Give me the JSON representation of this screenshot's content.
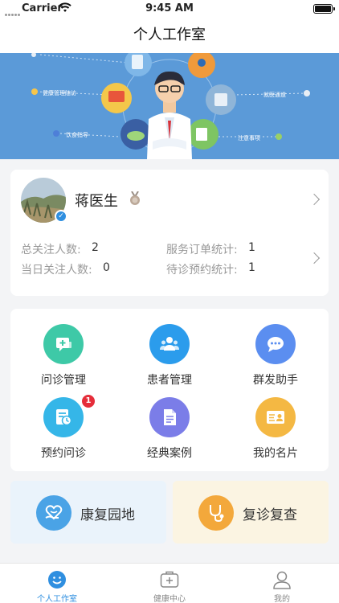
{
  "status_bar": {
    "carrier": "Carrier",
    "time": "9:45 AM"
  },
  "nav": {
    "title": "个人工作室"
  },
  "banner": {
    "labels": [
      "健康管理随访",
      "饮食指导",
      "就医通道",
      "注意事项"
    ]
  },
  "doctor": {
    "name": "蒋医生",
    "stats": {
      "total_followers_label": "总关注人数:",
      "total_followers_value": "2",
      "service_orders_label": "服务订单统计:",
      "service_orders_value": "1",
      "today_followers_label": "当日关注人数:",
      "today_followers_value": "0",
      "pending_appointments_label": "待诊预约统计:",
      "pending_appointments_value": "1"
    }
  },
  "grid": {
    "items": [
      {
        "label": "问诊管理",
        "icon": "consultation-icon",
        "color": "#3ec9a7"
      },
      {
        "label": "患者管理",
        "icon": "patients-icon",
        "color": "#2b9cec"
      },
      {
        "label": "群发助手",
        "icon": "chat-bubble-icon",
        "color": "#5b8ef0"
      },
      {
        "label": "预约问诊",
        "icon": "appointment-icon",
        "color": "#35b6e8",
        "badge": "1"
      },
      {
        "label": "经典案例",
        "icon": "document-icon",
        "color": "#7b7de8"
      },
      {
        "label": "我的名片",
        "icon": "business-card-icon",
        "color": "#f4b843"
      }
    ]
  },
  "features": [
    {
      "label": "康复园地",
      "icon": "heart-hand-icon",
      "bg": "#eaf3fb",
      "color": "#4aa3e6"
    },
    {
      "label": "复诊复查",
      "icon": "stethoscope-icon",
      "bg": "#fbf4e2",
      "color": "#f3a83b"
    }
  ],
  "tabs": [
    {
      "label": "个人工作室",
      "icon": "smile-icon",
      "active": true
    },
    {
      "label": "健康中心",
      "icon": "medical-kit-icon",
      "active": false
    },
    {
      "label": "我的",
      "icon": "person-icon",
      "active": false
    }
  ],
  "colors": {
    "accent": "#2f8fe0",
    "banner": "#5b9ad8",
    "badge": "#e52d3a"
  }
}
